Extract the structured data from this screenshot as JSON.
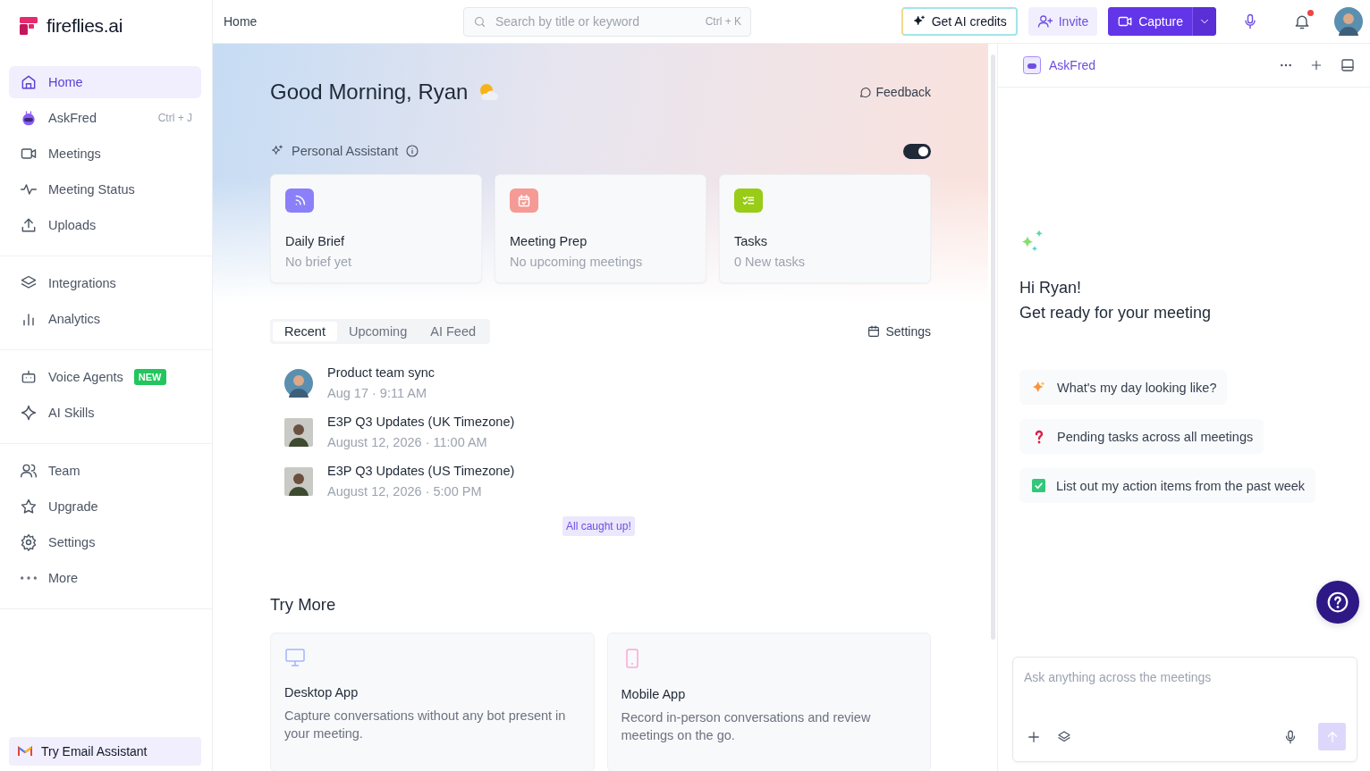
{
  "logo": {
    "text": "fireflies.ai"
  },
  "sidebar": {
    "groups": [
      {
        "items": [
          {
            "label": "Home",
            "selected": true
          },
          {
            "label": "AskFred",
            "selected": false,
            "shortcut": "Ctrl + J"
          },
          {
            "label": "Meetings",
            "selected": false
          },
          {
            "label": "Meeting Status",
            "selected": false
          },
          {
            "label": "Uploads",
            "selected": false
          }
        ]
      },
      {
        "items": [
          {
            "label": "Integrations",
            "selected": false
          },
          {
            "label": "Analytics",
            "selected": false
          }
        ]
      },
      {
        "items": [
          {
            "label": "Voice Agents",
            "selected": false,
            "badge": "NEW"
          },
          {
            "label": "AI Skills",
            "selected": false
          }
        ]
      },
      {
        "items": [
          {
            "label": "Team",
            "selected": false
          },
          {
            "label": "Upgrade",
            "selected": false
          },
          {
            "label": "Settings",
            "selected": false
          },
          {
            "label": "More",
            "selected": false
          }
        ]
      }
    ],
    "footer": {
      "label": "Try Email Assistant"
    }
  },
  "topbar": {
    "breadcrumb": "Home",
    "search": {
      "placeholder": "Search by title or keyword",
      "shortcut": "Ctrl + K"
    },
    "buttons": [
      {
        "label": "Get AI credits",
        "kind": "credits"
      },
      {
        "label": "Invite",
        "kind": "invite"
      },
      {
        "label": "Capture",
        "kind": "capture"
      }
    ],
    "notifications_unread": true
  },
  "home": {
    "greeting": "Good Morning, Ryan",
    "feedback": "Feedback",
    "assistant": {
      "label": "Personal Assistant",
      "on": true
    },
    "cards": [
      {
        "title": "Daily Brief",
        "subtitle": "No brief yet",
        "color": "#8b80f9"
      },
      {
        "title": "Meeting Prep",
        "subtitle": "No upcoming meetings",
        "color": "#f59a94"
      },
      {
        "title": "Tasks",
        "subtitle": "0 New tasks",
        "color": "#98cc16"
      }
    ],
    "tabs": [
      {
        "label": "Recent",
        "selected": true
      },
      {
        "label": "Upcoming",
        "selected": false
      },
      {
        "label": "AI Feed",
        "selected": false
      }
    ],
    "settings": "Settings",
    "meetings": [
      {
        "title": "Product team sync",
        "time": "Aug 17 · 9:11 AM",
        "kind": "round"
      },
      {
        "title": "E3P Q3 Updates (UK Timezone)",
        "time": "August 12, 2026 · 11:00 AM",
        "kind": "square"
      },
      {
        "title": "E3P Q3 Updates (US Timezone)",
        "time": "August 12, 2026 · 5:00 PM",
        "kind": "square"
      }
    ],
    "caught_up": "All caught up!",
    "try_more": {
      "title": "Try More",
      "cards": [
        {
          "title": "Desktop App",
          "description": "Capture conversations without any bot present in your meeting."
        },
        {
          "title": "Mobile App",
          "description": "Record in-person conversations and review meetings on the go."
        }
      ]
    }
  },
  "askfred": {
    "title": "AskFred",
    "greeting": "Hi Ryan!",
    "subtitle": "Get ready for your meeting",
    "prompts": [
      {
        "text": "What's my day looking like?"
      },
      {
        "text": "Pending tasks across all meetings"
      },
      {
        "text": "List out my action items from the past week"
      }
    ],
    "input": {
      "placeholder": "Ask anything across the meetings"
    }
  }
}
